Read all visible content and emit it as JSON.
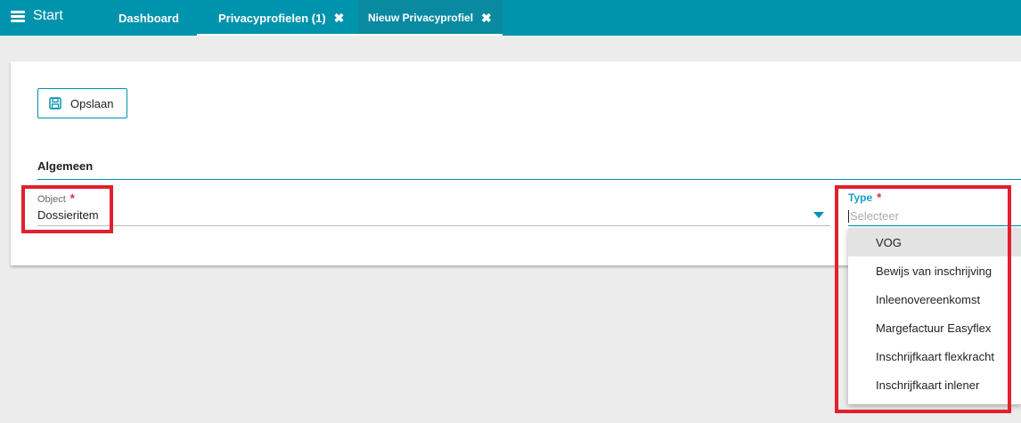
{
  "topbar": {
    "start_label": "Start",
    "tabs": [
      {
        "label": "Dashboard"
      },
      {
        "label": "Privacyprofielen (1)",
        "close": "✖"
      },
      {
        "label": "Nieuw Privacyprofiel",
        "close": "✖"
      }
    ]
  },
  "toolbar": {
    "save_label": "Opslaan"
  },
  "section": {
    "title": "Algemeen"
  },
  "form": {
    "object": {
      "label": "Object",
      "required_mark": "*",
      "value": "Dossieritem"
    },
    "type": {
      "label": "Type",
      "required_mark": "*",
      "placeholder": "Selecteer",
      "options": [
        "VOG",
        "Bewijs van inschrijving",
        "Inleenovereenkomst",
        "Margefactuur Easyflex",
        "Inschrijfkaart flexkracht",
        "Inschrijfkaart inlener"
      ],
      "highlighted_option": "VOG"
    }
  },
  "colors": {
    "brand": "#0093ad",
    "highlight_box": "#e2202e",
    "required": "#e8203a"
  }
}
